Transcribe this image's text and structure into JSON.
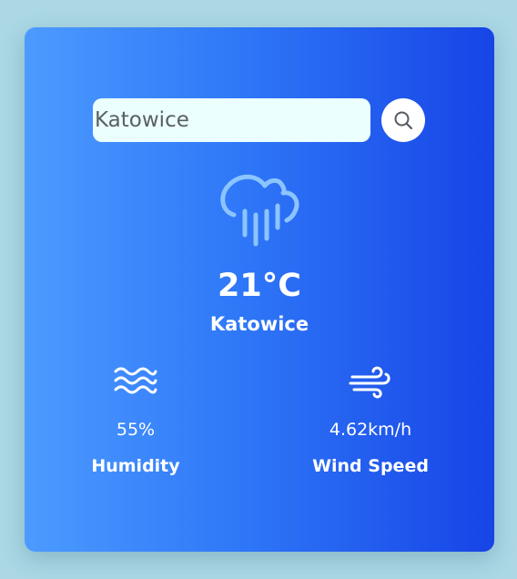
{
  "search": {
    "value": "Katowice",
    "placeholder": "Katowice",
    "button_icon": "search-icon"
  },
  "weather": {
    "icon": "rain-cloud-icon",
    "temperature": "21°C",
    "city": "Katowice"
  },
  "humidity": {
    "icon": "humidity-waves-icon",
    "value": "55%",
    "label": "Humidity"
  },
  "wind": {
    "icon": "wind-icon",
    "value": "4.62km/h",
    "label": "Wind Speed"
  },
  "colors": {
    "background": "#abd8e4",
    "card_gradient_start": "#4c9bff",
    "card_gradient_end": "#1744e6",
    "input_background": "#ebffff",
    "icon_light_blue": "#8cc4ff"
  }
}
